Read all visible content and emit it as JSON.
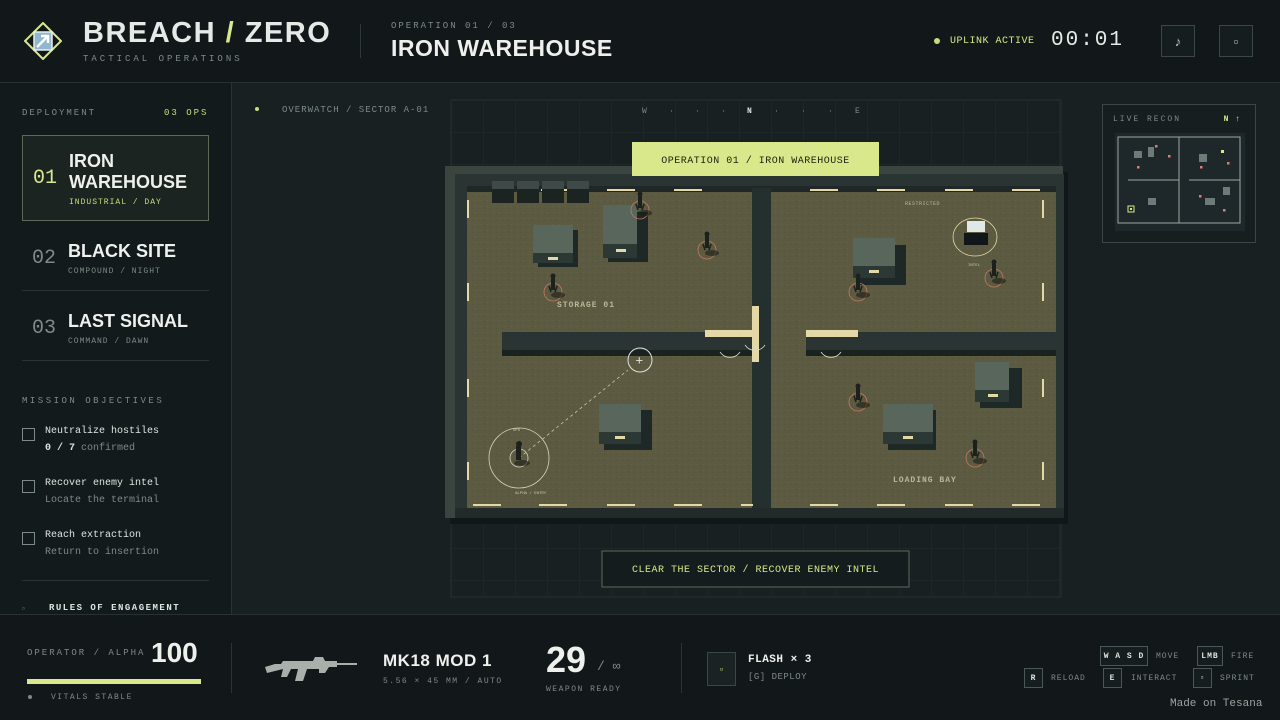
{
  "header": {
    "brand_left": "BREACH",
    "brand_slash": "/",
    "brand_right": "ZERO",
    "brand_sub": "TACTICAL OPERATIONS",
    "op_label": "OPERATION 01 / 03",
    "op_title": "IRON WAREHOUSE",
    "uplink": "UPLINK ACTIVE",
    "timer": "00:01",
    "sound_icon": "♪",
    "menu_icon": "▫"
  },
  "sidebar": {
    "deployment_label": "DEPLOYMENT",
    "deployment_count": "03 OPS",
    "missions": [
      {
        "num": "01",
        "name": "IRON WAREHOUSE",
        "sub": "INDUSTRIAL / DAY"
      },
      {
        "num": "02",
        "name": "BLACK SITE",
        "sub": "COMPOUND / NIGHT"
      },
      {
        "num": "03",
        "name": "LAST SIGNAL",
        "sub": "COMMAND / DAWN"
      }
    ],
    "objectives_label": "MISSION OBJECTIVES",
    "objectives": [
      {
        "title": "Neutralize hostiles",
        "sub_count": "0 / 7",
        "sub_rest": "confirmed"
      },
      {
        "title": "Recover enemy intel",
        "sub": "Locate the terminal"
      },
      {
        "title": "Reach extraction",
        "sub": "Return to insertion"
      }
    ],
    "roe_icon": "▫",
    "roe": "RULES OF ENGAGEMENT"
  },
  "map": {
    "overwatch": "OVERWATCH / SECTOR A-01",
    "compass": [
      "W",
      "·",
      "·",
      "·",
      "N",
      "·",
      "·",
      "·",
      "E"
    ],
    "banner": "OPERATION 01 / IRON WAREHOUSE",
    "storage_label": "STORAGE 01",
    "loading_label": "LOADING BAY",
    "restricted_label": "RESTRICTED",
    "operator_tag": "ALPHA / ENTRY",
    "operator_small": "OPS",
    "intel_small": "INTEL",
    "directive": "CLEAR THE SECTOR / RECOVER ENEMY INTEL",
    "crosshair": "+"
  },
  "minimap": {
    "label": "LIVE RECON",
    "north": "N ↑"
  },
  "footer": {
    "operator": "OPERATOR / ALPHA",
    "health": "100",
    "health_pct": 100,
    "vitals": "VITALS STABLE",
    "weapon": "MK18 MOD 1",
    "weapon_spec": "5.56 × 45 MM / AUTO",
    "ammo": "29",
    "ammo_reserve": "/ ∞",
    "weapon_ready": "WEAPON READY",
    "gadget_icon": "▫",
    "gadget": "FLASH × 3",
    "gadget_deploy": "[G] DEPLOY",
    "controls": [
      {
        "key": "W A S D",
        "action": "MOVE"
      },
      {
        "key": "LMB",
        "action": "FIRE"
      },
      {
        "key": "R",
        "action": "RELOAD"
      },
      {
        "key": "E",
        "action": "INTERACT"
      },
      {
        "key": "▫",
        "action": "SPRINT"
      }
    ],
    "made": "Made on Tesana"
  },
  "colors": {
    "accent": "#d8e88a",
    "floor": "#5e5c44",
    "wall": "#2c3634",
    "panel": "#12181a"
  }
}
